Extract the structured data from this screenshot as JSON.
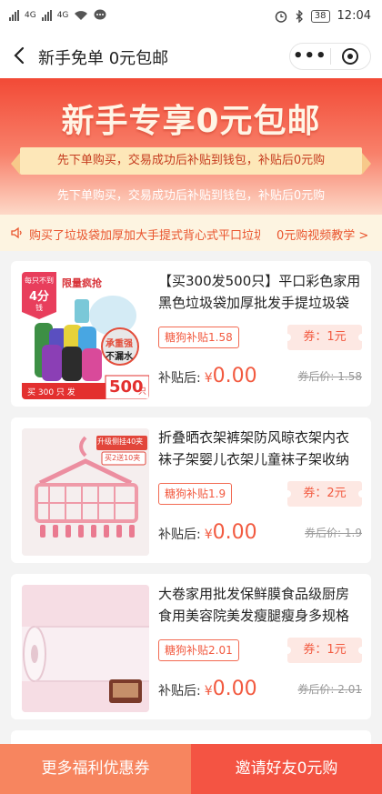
{
  "status_bar": {
    "network1": "4G",
    "network2": "4G",
    "battery": "38",
    "time": "12:04"
  },
  "nav": {
    "title": "新手免单 0元包邮",
    "more": "•••"
  },
  "banner": {
    "headline": "新手专享0元包邮",
    "ribbon": "先下单购买，交易成功后补贴到钱包，补贴后0元购",
    "subtext": "先下单购买，交易成功后补贴到钱包，补贴后0元购"
  },
  "notice": {
    "message": "购买了垃圾袋加厚加大手提式背心式平口垃圾袋",
    "link": "0元购视频教学 >"
  },
  "products": [
    {
      "title": "【买300发500只】平口彩色家用黑色垃圾袋加厚批发手提垃圾袋",
      "tag": "糖狗补贴1.58",
      "coupon": "券：1元",
      "after_label": "补贴后:",
      "currency": "¥",
      "after_price": "0.00",
      "orig_price": "券后价: 1.58",
      "img": {
        "badge_top": "每只不到",
        "badge_mid": "4分",
        "badge_bot": "钱",
        "promo": "限量疯抢",
        "seal1": "承重强",
        "seal2": "不漏水",
        "strip": "买 300 只 发",
        "big": "500",
        "unit": "只"
      }
    },
    {
      "title": "折叠晒衣架裤架防风晾衣架内衣袜子架婴儿衣架儿童袜子架收纳神器",
      "tag": "糖狗补贴1.9",
      "coupon": "券：2元",
      "after_label": "补贴后:",
      "currency": "¥",
      "after_price": "0.00",
      "orig_price": "券后价: 1.9",
      "img": {
        "badge1": "升级侧挂40夹",
        "badge2": "买2送10夹"
      }
    },
    {
      "title": "大卷家用批发保鲜膜食品级厨房食用美容院美发瘦腿瘦身多规格",
      "tag": "糖狗补贴2.01",
      "coupon": "券：1元",
      "after_label": "补贴后:",
      "currency": "¥",
      "after_price": "0.00",
      "orig_price": "券后价: 2.01"
    }
  ],
  "footer": {
    "left": "更多福利优惠券",
    "right": "邀请好友0元购"
  },
  "colors": {
    "accent": "#f25a40",
    "banner_top": "#f24a36",
    "footer_left": "#f7855f",
    "footer_right": "#f45443"
  }
}
